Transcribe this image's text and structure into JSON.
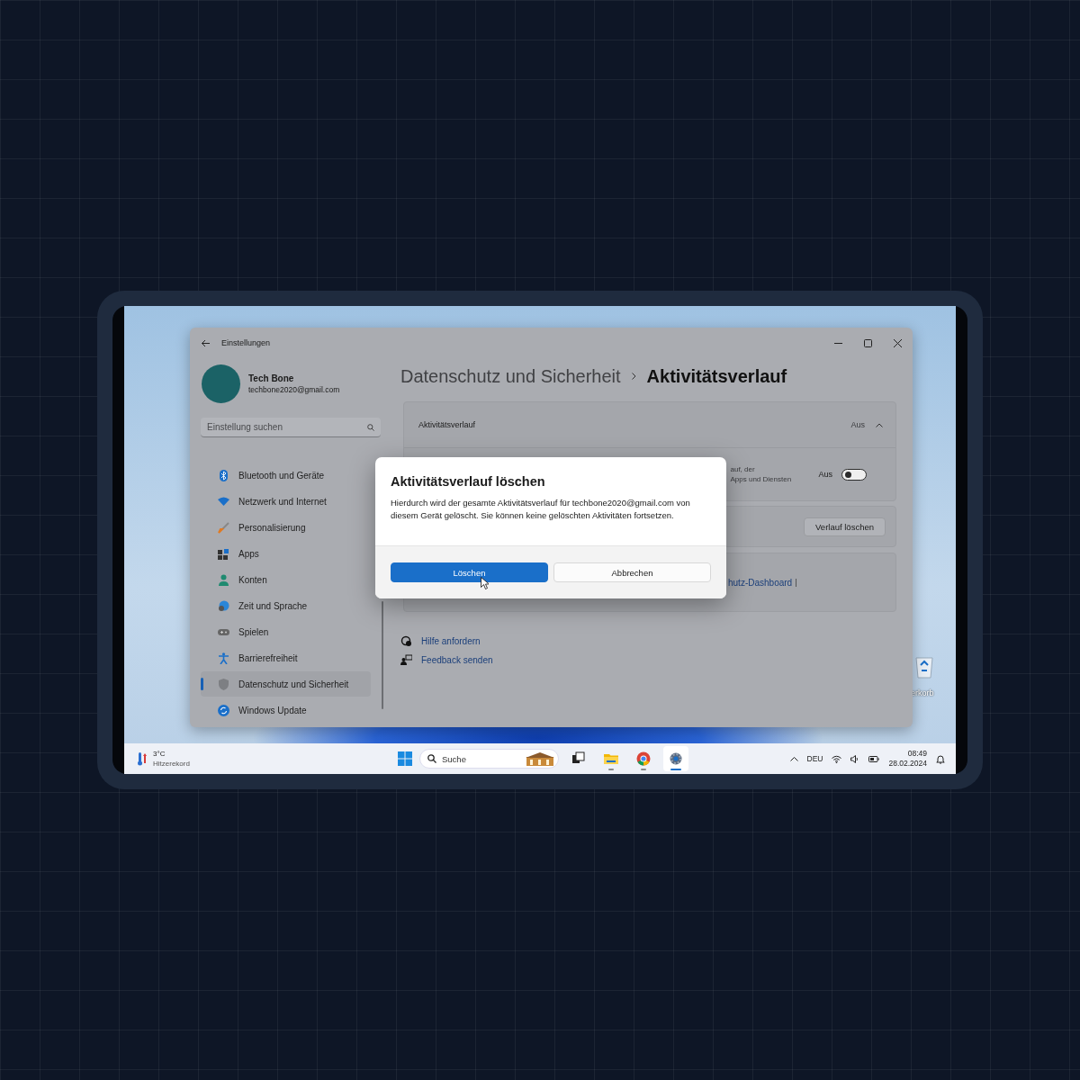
{
  "desktop": {
    "icon_label": "erkorb"
  },
  "window": {
    "title": "Einstellungen",
    "profile": {
      "name": "Tech Bone",
      "email": "techbone2020@gmail.com"
    },
    "search": {
      "placeholder": "Einstellung suchen"
    },
    "nav": [
      {
        "label": "Bluetooth und Geräte",
        "selected": false
      },
      {
        "label": "Netzwerk und Internet",
        "selected": false
      },
      {
        "label": "Personalisierung",
        "selected": false
      },
      {
        "label": "Apps",
        "selected": false
      },
      {
        "label": "Konten",
        "selected": false
      },
      {
        "label": "Zeit und Sprache",
        "selected": false
      },
      {
        "label": "Spielen",
        "selected": false
      },
      {
        "label": "Barrierefreiheit",
        "selected": false
      },
      {
        "label": "Datenschutz und Sicherheit",
        "selected": true
      },
      {
        "label": "Windows Update",
        "selected": false
      }
    ],
    "breadcrumb": {
      "parent": "Datenschutz und Sicherheit",
      "current": "Aktivitätsverlauf"
    },
    "section": {
      "title": "Aktivitätsverlauf",
      "status": "Aus",
      "expanded": true,
      "setting": {
        "description_lines": [
          "auf, der",
          "Apps und Diensten"
        ],
        "state_label": "Aus",
        "on": false
      }
    },
    "clear_button": "Verlauf löschen",
    "dashboard_link": "hutz-Dashboard",
    "links": [
      "Hilfe anfordern",
      "Feedback senden"
    ]
  },
  "dialog": {
    "title": "Aktivitätsverlauf löschen",
    "body": "Hierdurch wird der gesamte Aktivitätsverlauf für techbone2020@gmail.com von diesem Gerät gelöscht. Sie können keine gelöschten Aktivitäten fortsetzen.",
    "buttons": [
      {
        "label": "Löschen",
        "primary": true
      },
      {
        "label": "Abbrechen",
        "primary": false
      }
    ]
  },
  "taskbar": {
    "weather": {
      "temp": "3°C",
      "caption": "Hitzerekord"
    },
    "search_placeholder": "Suche",
    "apps": [
      {
        "active": false
      },
      {
        "active": false
      },
      {
        "active": false
      },
      {
        "active": true
      }
    ],
    "language": "DEU",
    "time": "08:49",
    "date": "28.02.2024"
  }
}
